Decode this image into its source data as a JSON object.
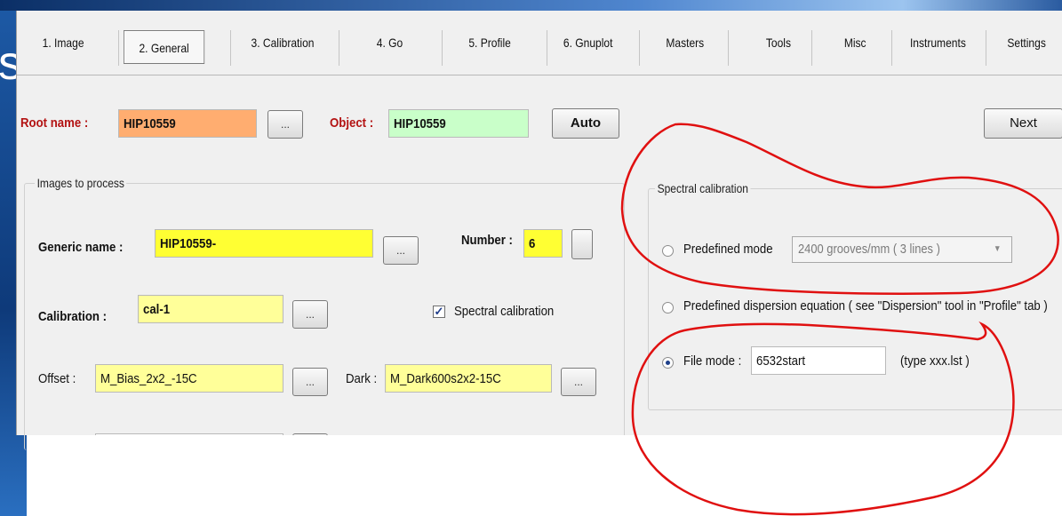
{
  "tabs": [
    {
      "label": "1. Image"
    },
    {
      "label": "2. General"
    },
    {
      "label": "3. Calibration"
    },
    {
      "label": "4. Go"
    },
    {
      "label": "5. Profile"
    },
    {
      "label": "6. Gnuplot"
    },
    {
      "label": "Masters"
    },
    {
      "label": "Tools"
    },
    {
      "label": "Misc"
    },
    {
      "label": "Instruments"
    },
    {
      "label": "Settings"
    }
  ],
  "active_tab": "2. General",
  "background_text": "s",
  "header": {
    "root_label": "Root name :",
    "root_value": "HIP10559",
    "browse_label": "...",
    "object_label": "Object :",
    "object_value": "HIP10559",
    "auto_label": "Auto",
    "next_label": "Next"
  },
  "images_group": {
    "title": "Images to process",
    "generic_label": "Generic name :",
    "generic_value": "HIP10559-",
    "number_label": "Number :",
    "number_value": "6",
    "calibration_label": "Calibration :",
    "calibration_value": "cal-1",
    "spectral_check_label": "Spectral calibration",
    "spectral_checked": true,
    "offset_label": "Offset :",
    "offset_value": "M_Bias_2x2_-15C",
    "dark_label": "Dark :",
    "dark_value": "M_Dark600s2x2-15C",
    "browse_label": "..."
  },
  "spectral_group": {
    "title": "Spectral calibration",
    "predefined_label": "Predefined mode",
    "predefined_select": "2400 grooves/mm ( 3 lines )",
    "dispersion_label": "Predefined dispersion equation ( see \"Dispersion\" tool in \"Profile\" tab )",
    "file_label": "File mode :",
    "file_value": "6532start",
    "file_hint": "(type xxx.lst )",
    "selected": "File mode"
  },
  "colors": {
    "root_field": "#ffad70",
    "object_field": "#c9ffc9",
    "required_field": "#ffff33",
    "optional_field": "#ffff99",
    "annotation": "#e01010"
  }
}
